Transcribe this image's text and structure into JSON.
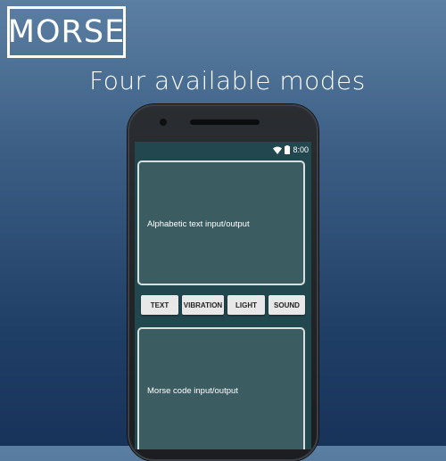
{
  "logo": {
    "text": "MORSE"
  },
  "headline": "Four available modes",
  "statusbar": {
    "time": "8:00",
    "icons": [
      "wifi-icon",
      "battery-icon"
    ]
  },
  "panels": {
    "text": {
      "label": "Alphabetic text input/output"
    },
    "morse": {
      "label": "Morse code input/output"
    }
  },
  "modes": {
    "text": "TEXT",
    "vibration": "VIBRATION",
    "light": "LIGHT",
    "sound": "SOUND"
  },
  "colors": {
    "background_top": "#5b7fa2",
    "background_bottom": "#18335a",
    "screen": "#22484f",
    "panel": "#3b5c61",
    "button": "#e8e8e8"
  }
}
